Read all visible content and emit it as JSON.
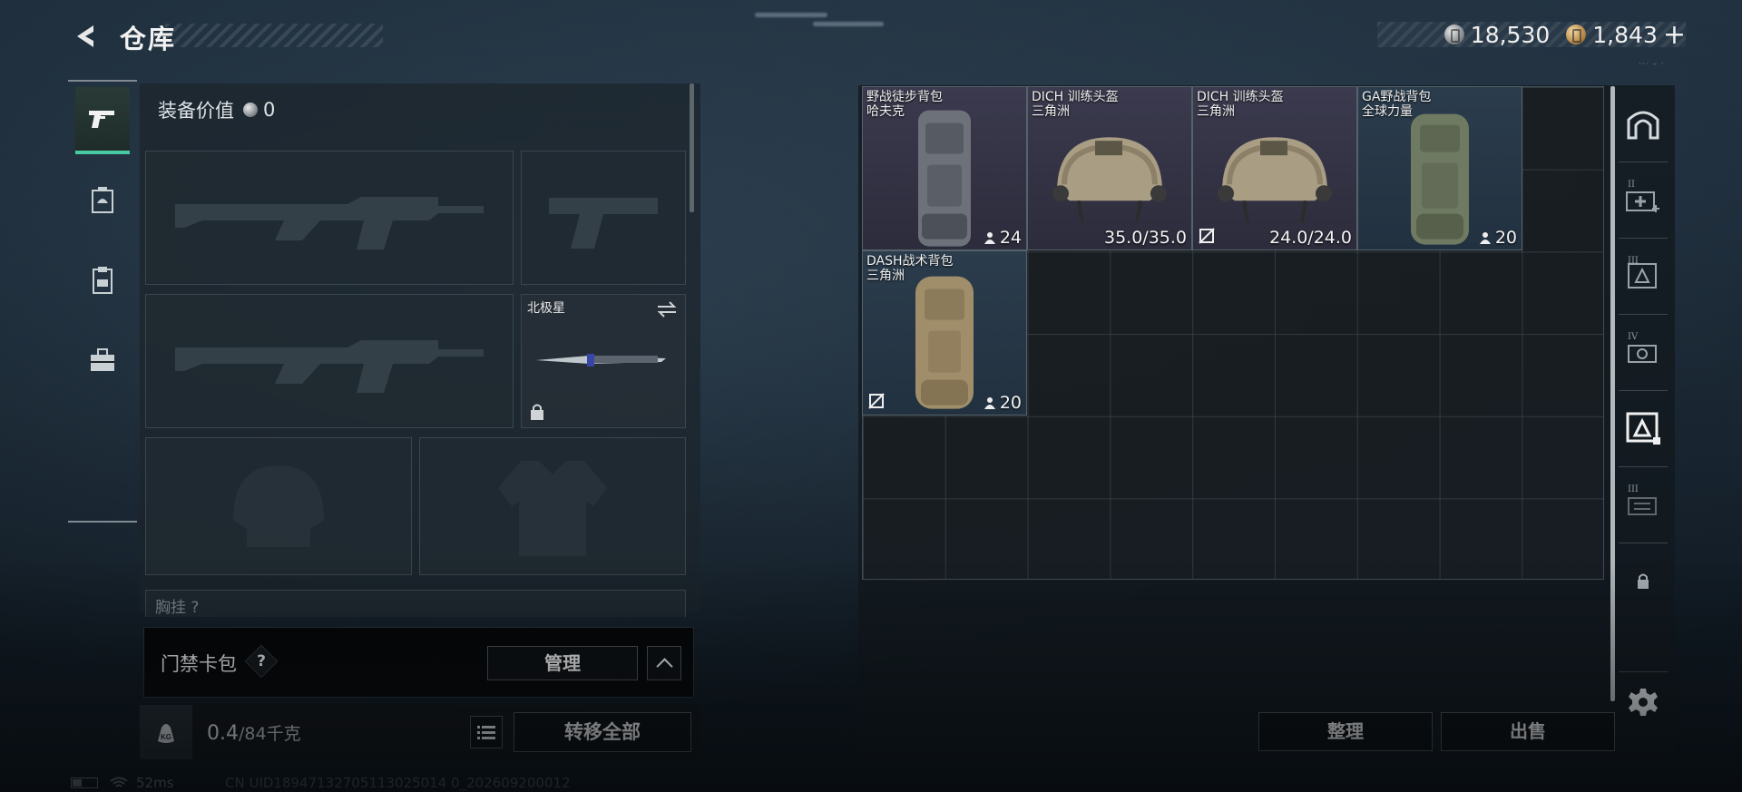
{
  "header": {
    "title": "仓库",
    "currencies": [
      {
        "icon": "silver-coin-icon",
        "value": "18,530"
      },
      {
        "icon": "gold-coin-icon",
        "value": "1,843"
      }
    ],
    "add_label": "+"
  },
  "left_nav": {
    "tabs": [
      {
        "icon": "pistol-icon",
        "active": true
      },
      {
        "icon": "helmet-case-icon",
        "active": false
      },
      {
        "icon": "clipboard-icon",
        "active": false
      },
      {
        "icon": "toolbox-icon",
        "active": false
      }
    ]
  },
  "loadout": {
    "equip_value_label": "装备价值",
    "equip_value": "0",
    "knife_name": "北极星",
    "chest_label": "胸挂 ?"
  },
  "access_card": {
    "label": "门禁卡包",
    "help": "?",
    "manage_label": "管理"
  },
  "weight": {
    "current": "0.4",
    "max": "/84千克",
    "transfer_label": "转移全部"
  },
  "status": {
    "ping": "52ms",
    "uid": "CN UID18947132705113025014 0_202609200012"
  },
  "stash": {
    "items": [
      {
        "name_line1": "野战徒步背包",
        "name_line2": "哈夫克",
        "stat": "24",
        "stat_icon": "capacity-icon",
        "rarity": "purple",
        "art": "backpack-grey"
      },
      {
        "name_line1": "DICH 训练头盔",
        "name_line2": "三角洲",
        "stat": "35.0/35.0",
        "stat_icon": "",
        "rarity": "purple",
        "art": "helmet"
      },
      {
        "name_line1": "DICH 训练头盔",
        "name_line2": "三角洲",
        "stat": "24.0/24.0",
        "stat_icon": "no-insurance-icon",
        "rarity": "purple",
        "art": "helmet"
      },
      {
        "name_line1": "GA野战背包",
        "name_line2": "全球力量",
        "stat": "20",
        "stat_icon": "capacity-icon",
        "rarity": "blue",
        "art": "backpack-green"
      },
      {
        "name_line1": "DASH战术背包",
        "name_line2": "三角洲",
        "stat": "20",
        "stat_icon": "capacity-icon",
        "rarity": "blue",
        "art": "backpack-tan"
      }
    ],
    "sort_label": "整理",
    "sell_label": "出售"
  },
  "right_tabs": [
    {
      "icon": "safebox-icon",
      "roman": ""
    },
    {
      "icon": "medkit-icon",
      "roman": "II"
    },
    {
      "icon": "armor-case-icon",
      "roman": "III"
    },
    {
      "icon": "weapon-case-icon",
      "roman": "IV"
    },
    {
      "icon": "armor-case-selected-icon",
      "roman": ""
    },
    {
      "icon": "ammo-case-icon",
      "roman": "III"
    },
    {
      "icon": "lock-icon",
      "roman": ""
    },
    {
      "icon": "gear-icon",
      "roman": ""
    }
  ],
  "colors": {
    "accent_green": "#48c9a2",
    "rarity_purple": "#3b3a4e",
    "rarity_blue": "#2b3c4c"
  }
}
